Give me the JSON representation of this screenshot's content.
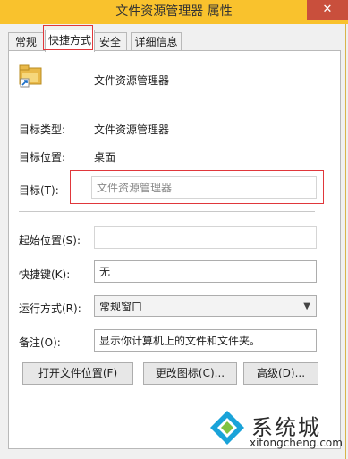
{
  "window": {
    "title": "文件资源管理器 属性",
    "close_glyph": "✕"
  },
  "tabs": [
    {
      "label": "常规"
    },
    {
      "label": "快捷方式"
    },
    {
      "label": "安全"
    },
    {
      "label": "详细信息"
    }
  ],
  "shortcut": {
    "name": "文件资源管理器",
    "target_type_label": "目标类型:",
    "target_type_value": "文件资源管理器",
    "target_location_label": "目标位置:",
    "target_location_value": "桌面",
    "target_label": "目标(T):",
    "target_value": "文件资源管理器",
    "start_in_label": "起始位置(S):",
    "start_in_value": "",
    "hotkey_label": "快捷键(K):",
    "hotkey_value": "无",
    "run_label": "运行方式(R):",
    "run_value": "常规窗口",
    "comment_label": "备注(O):",
    "comment_value": "显示你计算机上的文件和文件夹。"
  },
  "buttons": {
    "open_location": "打开文件位置(F)",
    "change_icon": "更改图标(C)...",
    "advanced": "高级(D)..."
  },
  "watermark": {
    "name": "系统城",
    "url": "xitongcheng.com"
  },
  "colors": {
    "title_bar": "#f9c22d",
    "close_button": "#c94f3c",
    "highlight": "#e0373b",
    "logo_blue": "#1aa3d9"
  }
}
